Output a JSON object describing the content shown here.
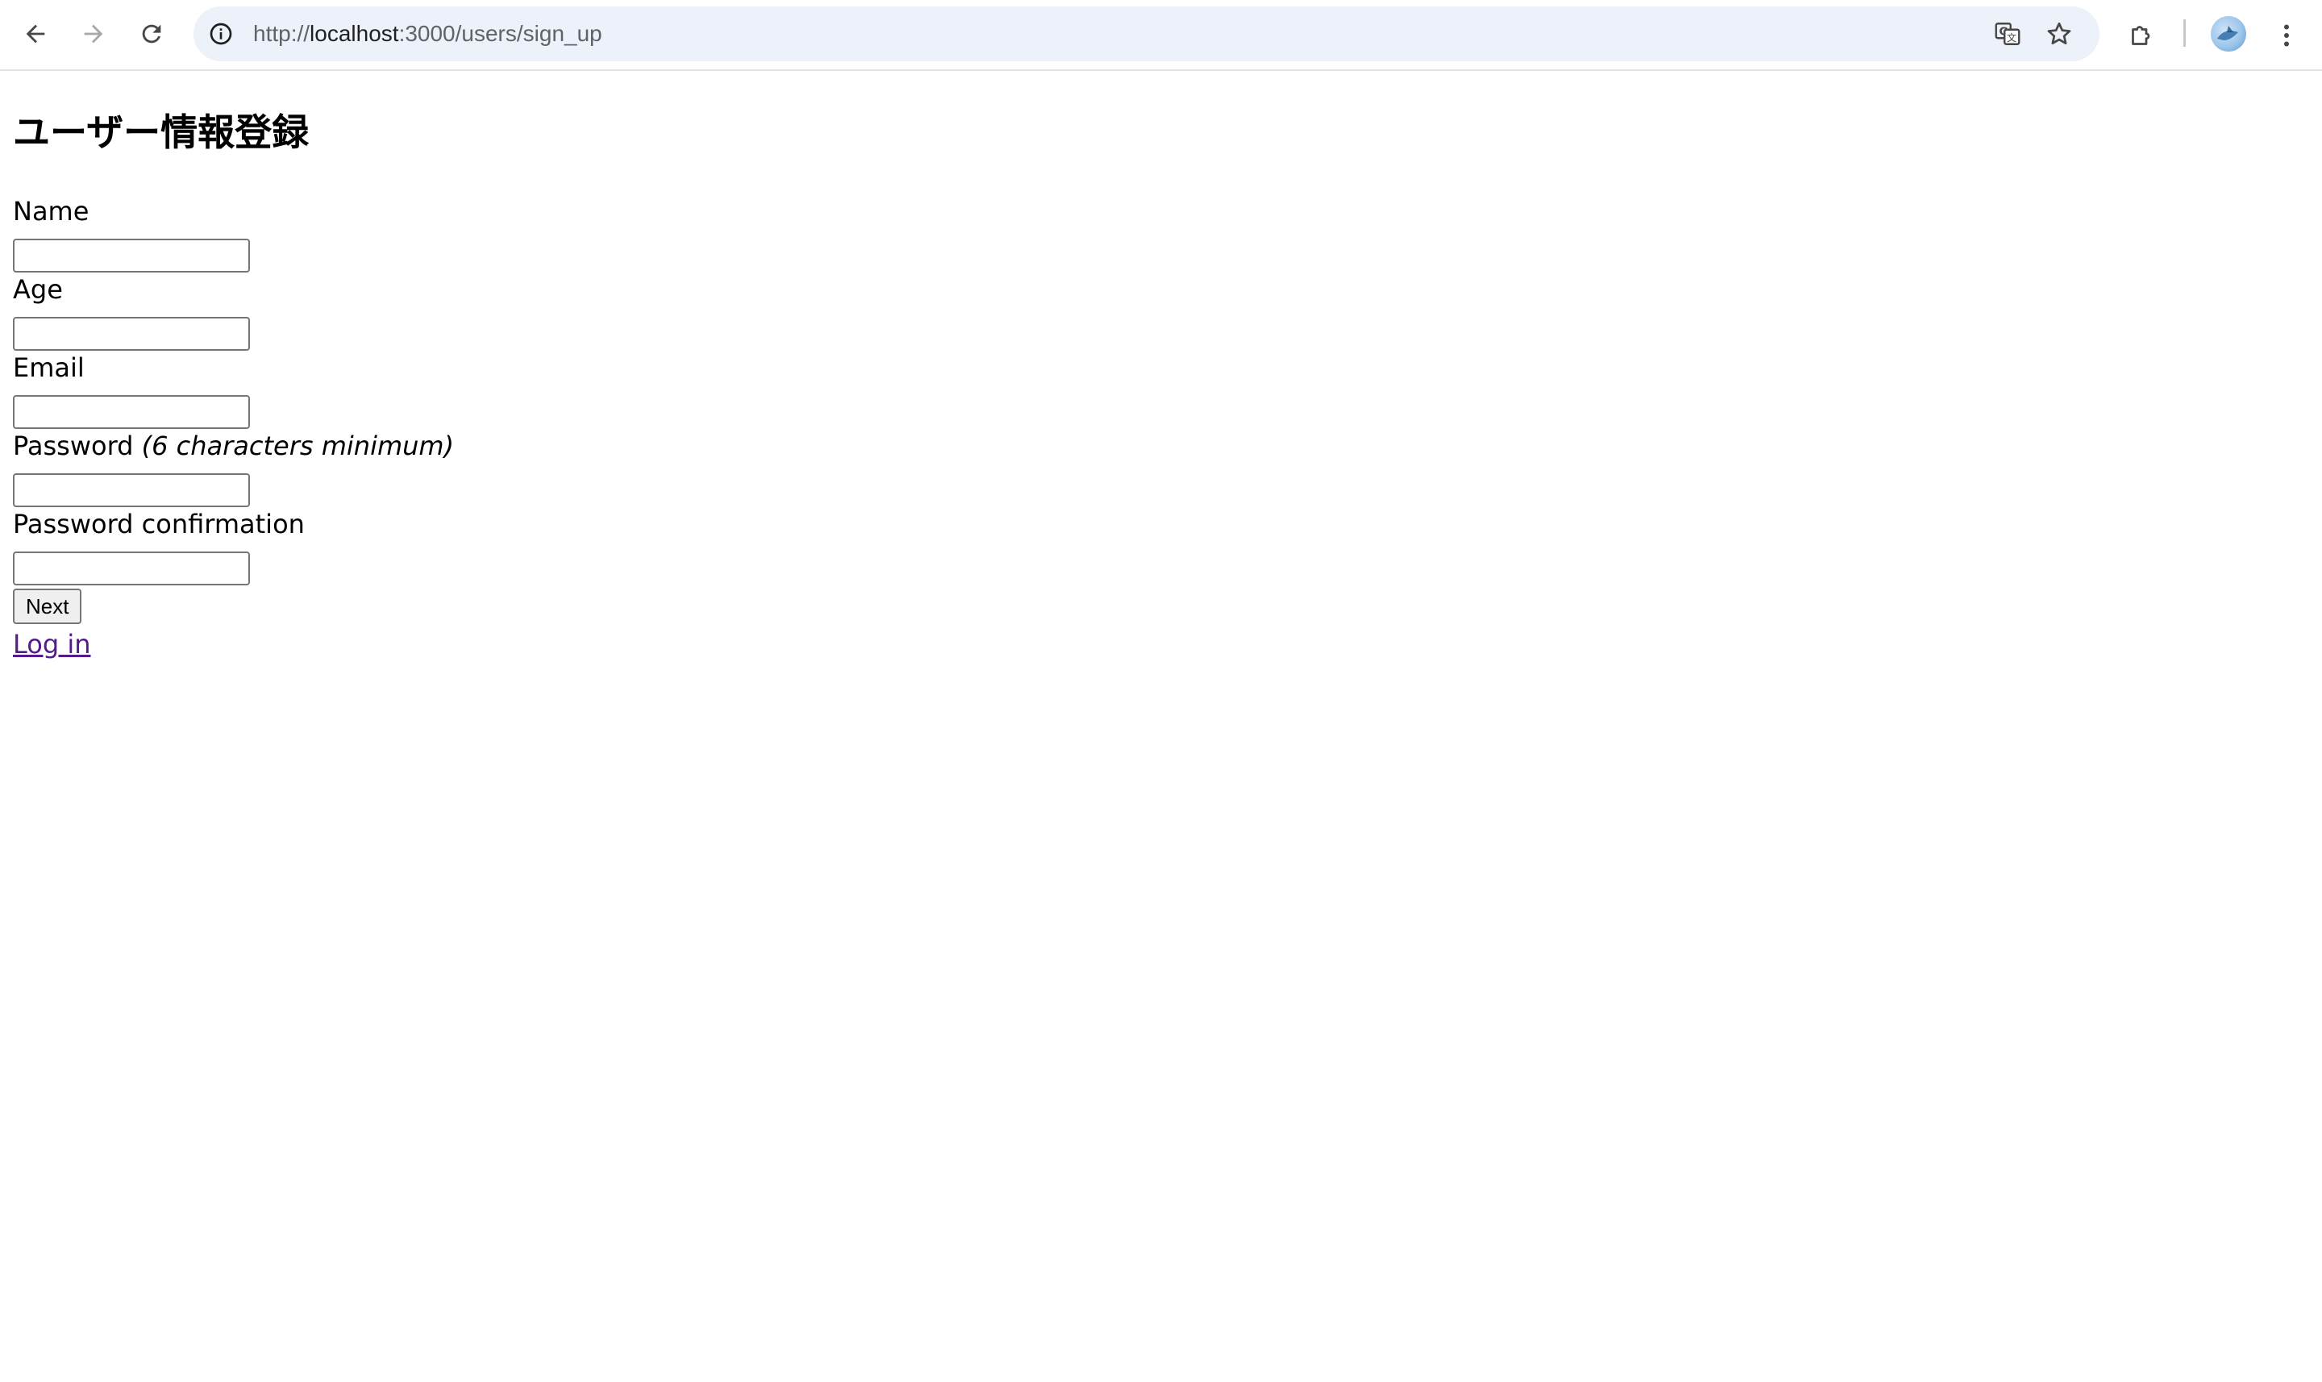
{
  "browser": {
    "url_prefix": "http://",
    "url_host": "localhost",
    "url_rest": ":3000/users/sign_up",
    "icons": {
      "back": "arrow-left-icon",
      "forward": "arrow-right-icon",
      "reload": "reload-icon",
      "site_info": "info-icon",
      "translate": "translate-icon",
      "bookmark": "star-icon",
      "extensions": "puzzle-icon",
      "profile": "avatar",
      "menu": "kebab-menu-icon"
    }
  },
  "page": {
    "title": "ユーザー情報登録",
    "fields": {
      "name": {
        "label": "Name",
        "value": ""
      },
      "age": {
        "label": "Age",
        "value": ""
      },
      "email": {
        "label": "Email",
        "value": ""
      },
      "password": {
        "label": "Password",
        "hint": "(6 characters minimum)",
        "value": ""
      },
      "password_confirmation": {
        "label": "Password confirmation",
        "value": ""
      }
    },
    "submit_label": "Next",
    "login_link": "Log in"
  },
  "colors": {
    "link_visited": "#551a8b",
    "omnibox_bg": "#edf2fa"
  }
}
